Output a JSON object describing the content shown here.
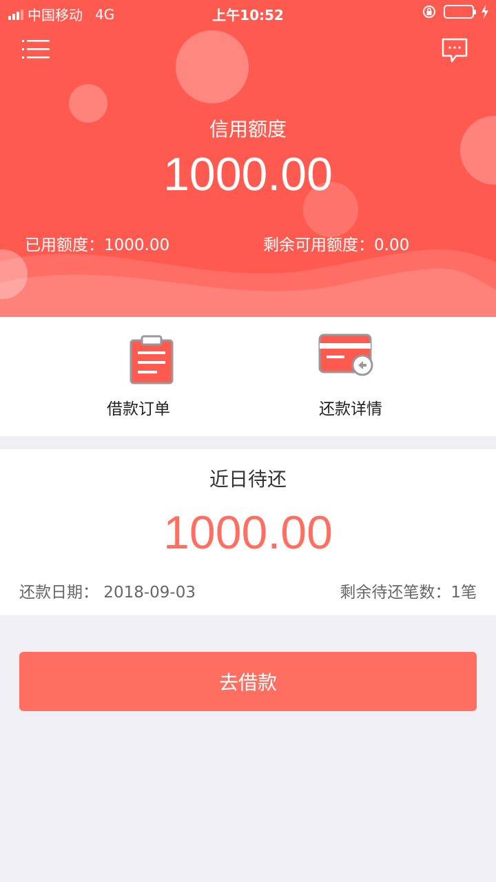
{
  "status_bar": {
    "carrier": "中国移动",
    "network": "4G",
    "time": "上午10:52"
  },
  "header": {
    "menu_icon": "menu-icon",
    "message_icon": "message-icon"
  },
  "credit": {
    "label": "信用额度",
    "amount": "1000.00",
    "used_label": "已用额度：1000.00",
    "remaining_label": "剩余可用额度：0.00"
  },
  "entries": [
    {
      "label": "借款订单",
      "icon": "clipboard-order-icon"
    },
    {
      "label": "还款详情",
      "icon": "card-repay-icon"
    }
  ],
  "due": {
    "title": "近日待还",
    "amount": "1000.00",
    "date_text": "还款日期：  2018-09-03",
    "count_text": "剩余待还笔数：1笔"
  },
  "action": {
    "borrow_label": "去借款"
  },
  "colors": {
    "primary": "#fe5a4f",
    "accent": "#ff6f61",
    "background": "#efeff4"
  }
}
